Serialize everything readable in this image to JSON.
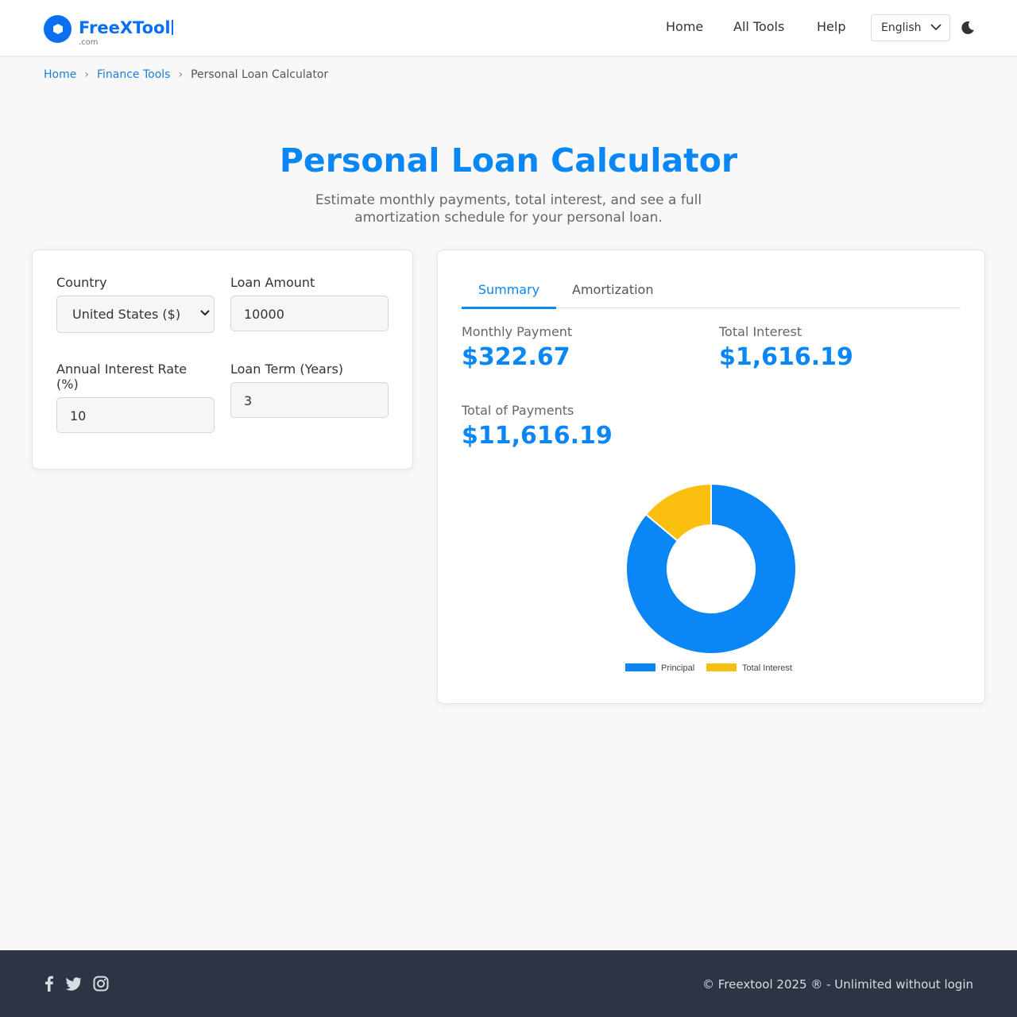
{
  "brand": {
    "name": "FreeXTool",
    "domain": ".com",
    "color": "#0a6ff0"
  },
  "nav": {
    "home": "Home",
    "all_tools": "All Tools",
    "help": "Help",
    "language": "English"
  },
  "breadcrumb": {
    "home": "Home",
    "category": "Finance Tools",
    "current": "Personal Loan Calculator"
  },
  "hero": {
    "title": "Personal Loan Calculator",
    "subtitle": "Estimate monthly payments, total interest, and see a full amortization schedule for your personal loan."
  },
  "form": {
    "country_label": "Country",
    "country_value": "United States ($)",
    "amount_label": "Loan Amount",
    "amount_value": "10000",
    "rate_label": "Annual Interest Rate (%)",
    "rate_value": "10",
    "term_label": "Loan Term (Years)",
    "term_value": "3"
  },
  "tabs": {
    "summary": "Summary",
    "amortization": "Amortization",
    "active": "summary"
  },
  "results": {
    "monthly_label": "Monthly Payment",
    "monthly_value": "$322.67",
    "interest_label": "Total Interest",
    "interest_value": "$1,616.19",
    "total_label": "Total of Payments",
    "total_value": "$11,616.19"
  },
  "chart_data": {
    "type": "pie",
    "categories": [
      "Principal",
      "Total Interest"
    ],
    "values": [
      10000,
      1616.19
    ],
    "colors": [
      "#0a86f5",
      "#fbbf0f"
    ],
    "legend": "bottom"
  },
  "footer": {
    "icons": [
      "facebook-icon",
      "twitter-icon",
      "instagram-icon"
    ],
    "copyright": "© Freextool 2025 ® - Unlimited without login"
  }
}
